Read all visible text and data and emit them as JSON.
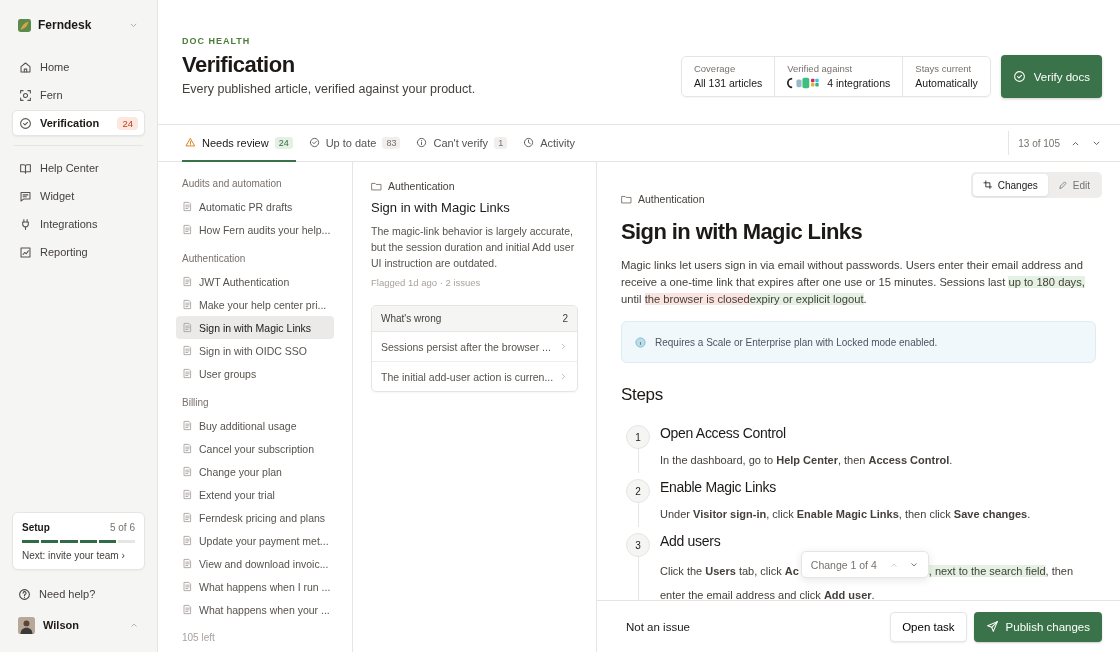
{
  "sidebar": {
    "workspace": "Ferndesk",
    "primary_nav": [
      {
        "label": "Home",
        "selected": false
      },
      {
        "label": "Fern",
        "selected": false
      },
      {
        "label": "Verification",
        "selected": true,
        "badge": "24"
      }
    ],
    "secondary_nav": [
      {
        "label": "Help Center",
        "selected": false
      },
      {
        "label": "Widget",
        "selected": false
      },
      {
        "label": "Integrations",
        "selected": false
      },
      {
        "label": "Reporting",
        "selected": false
      }
    ],
    "setup": {
      "title": "Setup",
      "count": "5 of 6",
      "level": 0.833,
      "next": "Next: invite your team",
      "arrow": "›"
    },
    "help": "Need help?",
    "user": {
      "name": "Wilson"
    }
  },
  "header": {
    "eyebrow": "DOC HEALTH",
    "title": "Verification",
    "subtitle": "Every published article, verified against your product.",
    "stats": [
      {
        "kind": "text",
        "label": "Coverage",
        "value": "All 131 articles"
      },
      {
        "kind": "integrations",
        "label": "Verified against",
        "value": "4 integrations"
      },
      {
        "kind": "text",
        "label": "Stays current",
        "value": "Automatically"
      }
    ],
    "primary_action": "Verify docs"
  },
  "tabs": [
    {
      "label": "Needs review",
      "count": "24",
      "selected": true
    },
    {
      "label": "Up to date",
      "count": "83",
      "selected": false
    },
    {
      "label": "Can't verify",
      "count": "1",
      "selected": false
    },
    {
      "label": "Activity",
      "selected": false
    }
  ],
  "pager": {
    "position": "13 of 105"
  },
  "articles": {
    "groups": [
      {
        "title": "Audits and automation",
        "items": [
          {
            "title": "Automatic PR drafts",
            "selected": false
          },
          {
            "title": "How Fern audits your help...",
            "selected": false
          }
        ]
      },
      {
        "title": "Authentication",
        "items": [
          {
            "title": "JWT Authentication",
            "selected": false
          },
          {
            "title": "Make your help center pri...",
            "selected": false
          },
          {
            "title": "Sign in with Magic Links",
            "selected": true
          },
          {
            "title": "Sign in with OIDC SSO",
            "selected": false
          },
          {
            "title": "User groups",
            "selected": false
          }
        ]
      },
      {
        "title": "Billing",
        "items": [
          {
            "title": "Buy additional usage",
            "selected": false
          },
          {
            "title": "Cancel your subscription",
            "selected": false
          },
          {
            "title": "Change your plan",
            "selected": false
          },
          {
            "title": "Extend your trial",
            "selected": false
          },
          {
            "title": "Ferndesk pricing and plans",
            "selected": false
          },
          {
            "title": "Update your payment met...",
            "selected": false
          },
          {
            "title": "View and download invoic...",
            "selected": false
          },
          {
            "title": "What happens when I run ...",
            "selected": false
          },
          {
            "title": "What happens when your ...",
            "selected": false
          }
        ]
      }
    ],
    "remaining": "105 left"
  },
  "summary": {
    "folder": "Authentication",
    "title": "Sign in with Magic Links",
    "description": "The magic-link behavior is largely accurate, but the session duration and initial Add user UI instruction are outdated.",
    "meta": "Flagged 1d ago · 2 issues",
    "issues": {
      "title": "What's wrong",
      "count": "2",
      "items": [
        "Sessions persist after the browser ...",
        "The initial add-user action is curren..."
      ]
    }
  },
  "detail": {
    "view_toggle": [
      {
        "label": "Changes",
        "selected": true
      },
      {
        "label": "Edit",
        "selected": false
      }
    ],
    "folder": "Authentication",
    "title": "Sign in with Magic Links",
    "intro": [
      {
        "kind": "plain",
        "text": "Magic links let users sign in via email without passwords. Users enter their email address and receive a one-time link that expires after one use or 15 minutes. Sessions last "
      },
      {
        "kind": "added",
        "text": "up to 180 days,"
      },
      {
        "kind": "plain",
        "text": " until "
      },
      {
        "kind": "removed",
        "text": "the browser is closed"
      },
      {
        "kind": "added",
        "text": "expiry or explicit logout"
      },
      {
        "kind": "plain",
        "text": "."
      }
    ],
    "callout": "Requires a Scale or Enterprise plan with Locked mode enabled.",
    "steps_heading": "Steps",
    "steps": [
      {
        "number": "1",
        "title": "Open Access Control",
        "body": [
          {
            "kind": "plain",
            "text": "In the dashboard, go to **Help Center**, then **Access Control**."
          }
        ]
      },
      {
        "number": "2",
        "title": "Enable Magic Links",
        "body": [
          {
            "kind": "plain",
            "text": "Under **Visitor sign-in**, click **Enable Magic Links**, then click **Save changes**."
          }
        ]
      },
      {
        "number": "3",
        "title": "Add users",
        "body": [
          {
            "kind": "plain",
            "text": "Click the **Users** tab, click **Ac**"
          }
        ],
        "change_popup": {
          "label": "Change 1 of 4"
        },
        "body_after": [
          {
            "kind": "added",
            "text": ", next to the search field"
          },
          {
            "kind": "plain",
            "text": ", then enter the email address and click **Add user**."
          }
        ]
      }
    ],
    "footer": {
      "dismiss": "Not an issue",
      "secondary": "Open task",
      "primary": "Publish changes"
    }
  }
}
